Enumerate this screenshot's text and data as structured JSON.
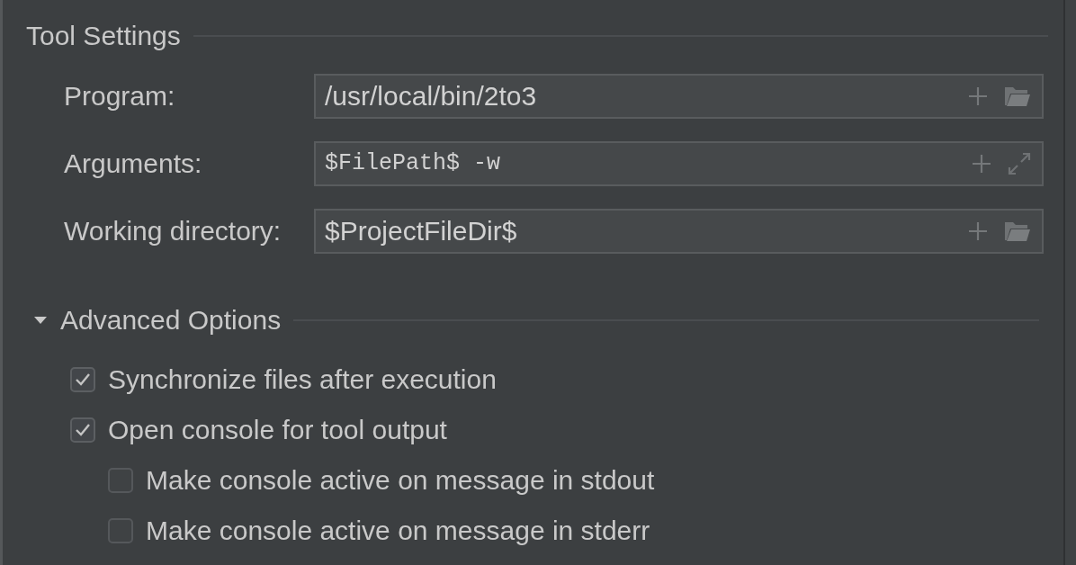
{
  "tool_settings": {
    "title": "Tool Settings",
    "fields": [
      {
        "label": "Program:",
        "value": "/usr/local/bin/2to3",
        "kind": "browse"
      },
      {
        "label": "Arguments:",
        "value": "$FilePath$ -w",
        "kind": "expand"
      },
      {
        "label": "Working directory:",
        "value": "$ProjectFileDir$",
        "kind": "browse"
      }
    ]
  },
  "advanced_options": {
    "title": "Advanced Options",
    "expanded": true,
    "options": [
      {
        "label": "Synchronize files after execution",
        "checked": true
      },
      {
        "label": "Open console for tool output",
        "checked": true,
        "children": [
          {
            "label": "Make console active on message in stdout",
            "checked": false
          },
          {
            "label": "Make console active on message in stderr",
            "checked": false
          }
        ]
      }
    ]
  }
}
